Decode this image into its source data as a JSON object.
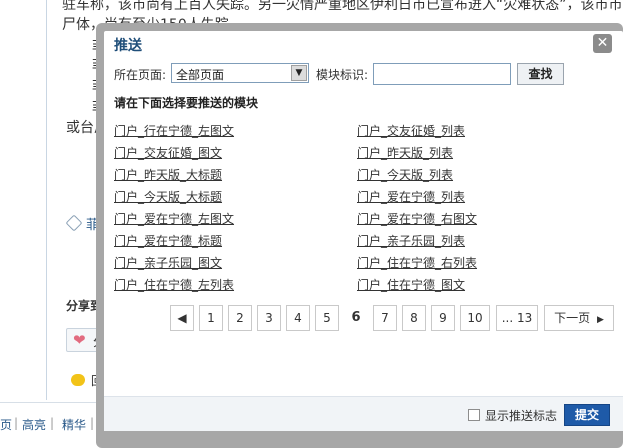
{
  "background": {
    "lines": [
      "驻车称，该市尚有上百人失踪。另一灾情严重地区伊利日市已宣布进入“灾难状态”，该市市",
      "尸体，尚有至少150人失踪。",
      "菲",
      "菲",
      "菲",
      "菲",
      "或台风"
    ],
    "tag_text": "菲律",
    "share_heading": "分享到",
    "share_button_text": "分",
    "reply_text": "回",
    "footer_links": [
      "页",
      "高亮",
      "精华",
      "団"
    ],
    "footer_sep": "|"
  },
  "modal": {
    "title": "推送",
    "close_symbol": "✕",
    "page_label": "所在页面:",
    "page_select_value": "全部页面",
    "select_arrow": "▼",
    "module_id_label": "模块标识:",
    "module_id_value": "",
    "search_label": "查找",
    "section_heading": "请在下面选择要推送的模块",
    "modules_left": [
      "门户_行在宁德_左图文",
      "门户_交友征婚_图文",
      "门户_昨天版_大标题",
      "门户_今天版_大标题",
      "门户_爱在宁德_左图文",
      "门户_爱在宁德_标题",
      "门户_亲子乐园_图文",
      "门户_住在宁德_左列表"
    ],
    "modules_right": [
      "门户_交友征婚_列表",
      "门户_昨天版_列表",
      "门户_今天版_列表",
      "门户_爱在宁德_列表",
      "门户_爱在宁德_右图文",
      "门户_亲子乐园_列表",
      "门户_住在宁德_右列表",
      "门户_住在宁德_图文"
    ],
    "pagination": {
      "prev_symbol": "◀",
      "pages": [
        "1",
        "2",
        "3",
        "4",
        "5",
        "6",
        "7",
        "8",
        "9",
        "10",
        "... 13"
      ],
      "current_page": "6",
      "next_label": "下一页",
      "next_symbol": "▶"
    },
    "show_push_flag_label": "显示推送标志",
    "show_push_flag_checked": false,
    "submit_label": "提交"
  },
  "colors": {
    "modal_title": "#1f4e79",
    "submit_button": "#1e5aa8",
    "overlay_border": "#a7a7a7"
  }
}
